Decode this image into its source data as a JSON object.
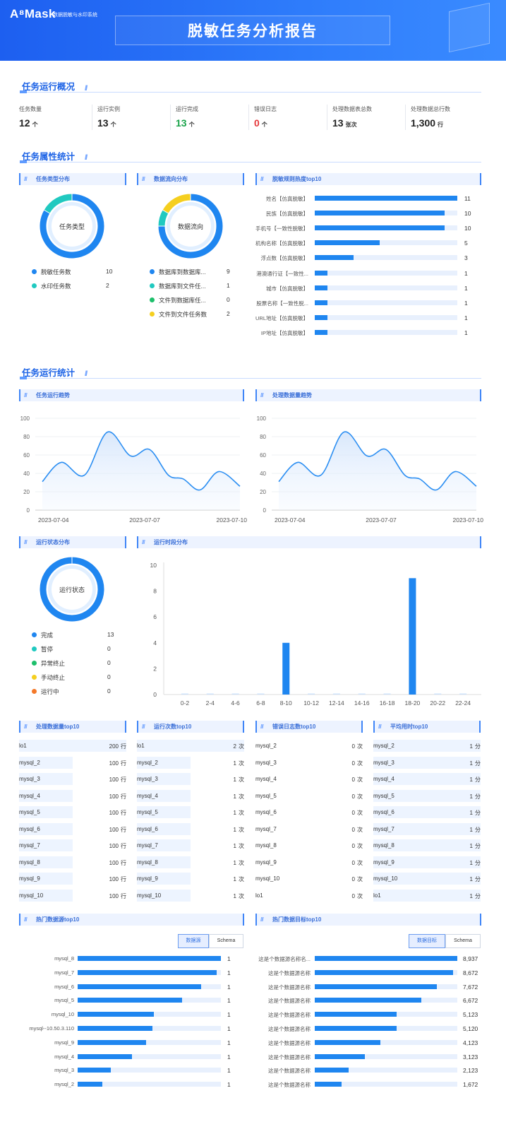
{
  "header": {
    "logo": "A⁸Mask",
    "logo_sub": "数据脱敏与水印系统",
    "title": "脱敏任务分析报告"
  },
  "sections": {
    "overview": "任务运行概况",
    "attributes": "任务属性统计",
    "running": "任务运行统计"
  },
  "kpis": [
    {
      "label": "任务数量",
      "value": "12",
      "unit": "个",
      "color": "#222222"
    },
    {
      "label": "运行实例",
      "value": "13",
      "unit": "个",
      "color": "#222222"
    },
    {
      "label": "运行完成",
      "value": "13",
      "unit": "个",
      "color": "#19a34a"
    },
    {
      "label": "错误日志",
      "value": "0",
      "unit": "个",
      "color": "#e5383b"
    },
    {
      "label": "处理数据表总数",
      "value": "13",
      "unit": "张次",
      "color": "#222222"
    },
    {
      "label": "处理数据总行数",
      "value": "1,300",
      "unit": "行",
      "color": "#222222"
    }
  ],
  "colors": {
    "blue": "#1f86f0",
    "cyan": "#20c9c0",
    "green": "#1dbf6b",
    "yellow": "#f5cf1f",
    "orange": "#f4792a",
    "accent": "#1e64e6"
  },
  "task_type": {
    "title": "任务类型分布",
    "center": "任务类型",
    "legend": [
      {
        "name": "脱敏任务数",
        "value": "10",
        "color": "#1f86f0"
      },
      {
        "name": "水印任务数",
        "value": "2",
        "color": "#20c9c0"
      }
    ],
    "slices": [
      10,
      2
    ]
  },
  "data_flow": {
    "title": "数据流向分布",
    "center": "数据流向",
    "legend": [
      {
        "name": "数据库到数据库...",
        "value": "9",
        "color": "#1f86f0"
      },
      {
        "name": "数据库到文件任...",
        "value": "1",
        "color": "#20c9c0"
      },
      {
        "name": "文件到数据库任...",
        "value": "0",
        "color": "#1dbf6b"
      },
      {
        "name": "文件到文件任务数",
        "value": "2",
        "color": "#f5cf1f"
      }
    ],
    "slices": [
      9,
      1,
      0,
      2
    ]
  },
  "rule_top10": {
    "title": "脱敏规则热度top10",
    "max": 11,
    "items": [
      {
        "name": "姓名【仿真脱敏】",
        "value": 11
      },
      {
        "name": "民族【仿真脱敏】",
        "value": 10
      },
      {
        "name": "手机号【一致性脱敏】",
        "value": 10
      },
      {
        "name": "机构名称【仿真脱敏】",
        "value": 5
      },
      {
        "name": "浮点数【仿真脱敏】",
        "value": 3
      },
      {
        "name": "港澳通行证【一致性...",
        "value": 1
      },
      {
        "name": "城市【仿真脱敏】",
        "value": 1
      },
      {
        "name": "股票名称【一致性脱...",
        "value": 1
      },
      {
        "name": "URL地址【仿真脱敏】",
        "value": 1
      },
      {
        "name": "IP地址【仿真脱敏】",
        "value": 1
      }
    ]
  },
  "trend1": {
    "title": "任务运行趋势"
  },
  "trend2": {
    "title": "处理数据量趋势"
  },
  "chart_data": [
    {
      "type": "line",
      "title": "任务运行趋势",
      "x": [
        "2023-07-04",
        "2023-07-05",
        "2023-07-06",
        "2023-07-07",
        "2023-07-08",
        "2023-07-09",
        "2023-07-10"
      ],
      "xticks": [
        "2023-07-04",
        "2023-07-07",
        "2023-07-10"
      ],
      "points": [
        [
          0,
          31
        ],
        [
          0.45,
          52
        ],
        [
          1,
          38
        ],
        [
          1.55,
          85
        ],
        [
          2.1,
          59
        ],
        [
          2.55,
          66
        ],
        [
          3,
          38
        ],
        [
          3.35,
          34
        ],
        [
          3.75,
          22
        ],
        [
          4.2,
          42
        ],
        [
          4.7,
          26
        ]
      ],
      "ylim": [
        0,
        100
      ],
      "yticks": [
        0,
        20,
        40,
        60,
        80,
        100
      ]
    },
    {
      "type": "line",
      "title": "处理数据量趋势",
      "x": [
        "2023-07-04",
        "2023-07-05",
        "2023-07-06",
        "2023-07-07",
        "2023-07-08",
        "2023-07-09",
        "2023-07-10"
      ],
      "xticks": [
        "2023-07-04",
        "2023-07-07",
        "2023-07-10"
      ],
      "points": [
        [
          0,
          31
        ],
        [
          0.45,
          52
        ],
        [
          1,
          38
        ],
        [
          1.55,
          85
        ],
        [
          2.1,
          59
        ],
        [
          2.55,
          66
        ],
        [
          3,
          38
        ],
        [
          3.35,
          34
        ],
        [
          3.75,
          22
        ],
        [
          4.2,
          42
        ],
        [
          4.7,
          26
        ]
      ],
      "ylim": [
        0,
        100
      ],
      "yticks": [
        0,
        20,
        40,
        60,
        80,
        100
      ]
    },
    {
      "type": "bar",
      "title": "运行时段分布",
      "categories": [
        "0-2",
        "2-4",
        "4-6",
        "6-8",
        "8-10",
        "10-12",
        "12-14",
        "14-16",
        "16-18",
        "18-20",
        "20-22",
        "22-24"
      ],
      "values": [
        0,
        0,
        0,
        0,
        4,
        0,
        0,
        0,
        0,
        9,
        0,
        0
      ],
      "ylim": [
        0,
        10
      ],
      "yticks": [
        0,
        2,
        4,
        6,
        8,
        10
      ]
    }
  ],
  "run_status": {
    "title": "运行状态分布",
    "center": "运行状态",
    "legend": [
      {
        "name": "完成",
        "value": "13",
        "color": "#1f86f0"
      },
      {
        "name": "暂停",
        "value": "0",
        "color": "#20c9c0"
      },
      {
        "name": "异常终止",
        "value": "0",
        "color": "#1dbf6b"
      },
      {
        "name": "手动终止",
        "value": "0",
        "color": "#f5cf1f"
      },
      {
        "name": "运行中",
        "value": "0",
        "color": "#f4792a"
      }
    ],
    "slices": [
      13,
      0,
      0,
      0,
      0
    ]
  },
  "time_dist": {
    "title": "运行时段分布"
  },
  "tables": [
    {
      "title": "处理数据量top10",
      "unit": "行",
      "rows": [
        [
          "lo1",
          "200"
        ],
        [
          "mysql_2",
          "100"
        ],
        [
          "mysql_3",
          "100"
        ],
        [
          "mysql_4",
          "100"
        ],
        [
          "mysql_5",
          "100"
        ],
        [
          "mysql_6",
          "100"
        ],
        [
          "mysql_7",
          "100"
        ],
        [
          "mysql_8",
          "100"
        ],
        [
          "mysql_9",
          "100"
        ],
        [
          "mysql_10",
          "100"
        ]
      ],
      "fill": [
        1,
        0.5,
        0.5,
        0.5,
        0.5,
        0.5,
        0.5,
        0.5,
        0.5,
        0.5
      ]
    },
    {
      "title": "运行次数top10",
      "unit": "次",
      "rows": [
        [
          "lo1",
          "2"
        ],
        [
          "mysql_2",
          "1"
        ],
        [
          "mysql_3",
          "1"
        ],
        [
          "mysql_4",
          "1"
        ],
        [
          "mysql_5",
          "1"
        ],
        [
          "mysql_6",
          "1"
        ],
        [
          "mysql_7",
          "1"
        ],
        [
          "mysql_8",
          "1"
        ],
        [
          "mysql_9",
          "1"
        ],
        [
          "mysql_10",
          "1"
        ]
      ],
      "fill": [
        1,
        0.5,
        0.5,
        0.5,
        0.5,
        0.5,
        0.5,
        0.5,
        0.5,
        0.5
      ]
    },
    {
      "title": "错误日志数top10",
      "unit": "次",
      "rows": [
        [
          "mysql_2",
          "0"
        ],
        [
          "mysql_3",
          "0"
        ],
        [
          "mysql_4",
          "0"
        ],
        [
          "mysql_5",
          "0"
        ],
        [
          "mysql_6",
          "0"
        ],
        [
          "mysql_7",
          "0"
        ],
        [
          "mysql_8",
          "0"
        ],
        [
          "mysql_9",
          "0"
        ],
        [
          "mysql_10",
          "0"
        ],
        [
          "lo1",
          "0"
        ]
      ],
      "fill": [
        0,
        0,
        0,
        0,
        0,
        0,
        0,
        0,
        0,
        0
      ]
    },
    {
      "title": "平均用时top10",
      "unit": "分",
      "rows": [
        [
          "mysql_2",
          "1"
        ],
        [
          "mysql_3",
          "1"
        ],
        [
          "mysql_4",
          "1"
        ],
        [
          "mysql_5",
          "1"
        ],
        [
          "mysql_6",
          "1"
        ],
        [
          "mysql_7",
          "1"
        ],
        [
          "mysql_8",
          "1"
        ],
        [
          "mysql_9",
          "1"
        ],
        [
          "mysql_10",
          "1"
        ],
        [
          "lo1",
          "1"
        ]
      ],
      "fill": [
        1,
        1,
        1,
        1,
        1,
        1,
        1,
        1,
        1,
        1
      ]
    }
  ],
  "hot_source": {
    "title": "热门数据源top10",
    "tabs": [
      "数据源",
      "Schema"
    ],
    "max": 1,
    "items": [
      {
        "name": "mysql_8",
        "value": 1,
        "fill": 1
      },
      {
        "name": "mysql_7",
        "value": 1,
        "fill": 0.97
      },
      {
        "name": "mysql_6",
        "value": 1,
        "fill": 0.86
      },
      {
        "name": "mysql_5",
        "value": 1,
        "fill": 0.73
      },
      {
        "name": "mysql_10",
        "value": 1,
        "fill": 0.53
      },
      {
        "name": "mysql--10.50.3.110",
        "value": 1,
        "fill": 0.52
      },
      {
        "name": "mysql_9",
        "value": 1,
        "fill": 0.48
      },
      {
        "name": "mysql_4",
        "value": 1,
        "fill": 0.38
      },
      {
        "name": "mysql_3",
        "value": 1,
        "fill": 0.23
      },
      {
        "name": "mysql_2",
        "value": 1,
        "fill": 0.17
      }
    ]
  },
  "hot_target": {
    "title": "热门数据目标top10",
    "tabs": [
      "数据目标",
      "Schema"
    ],
    "max": 8937,
    "items": [
      {
        "name": "这是个数据源名称名...",
        "value": "8,937",
        "num": 8937
      },
      {
        "name": "这是个数据源名称",
        "value": "8,672",
        "num": 8672
      },
      {
        "name": "这是个数据源名称",
        "value": "7,672",
        "num": 7672
      },
      {
        "name": "这是个数据源名称",
        "value": "6,672",
        "num": 6672
      },
      {
        "name": "这是个数据源名称",
        "value": "5,123",
        "num": 5123
      },
      {
        "name": "这是个数据源名称",
        "value": "5,120",
        "num": 5120
      },
      {
        "name": "这是个数据源名称",
        "value": "4,123",
        "num": 4123
      },
      {
        "name": "这是个数据源名称",
        "value": "3,123",
        "num": 3123
      },
      {
        "name": "这是个数据源名称",
        "value": "2,123",
        "num": 2123
      },
      {
        "name": "这是个数据源名称",
        "value": "1,672",
        "num": 1672
      }
    ]
  }
}
